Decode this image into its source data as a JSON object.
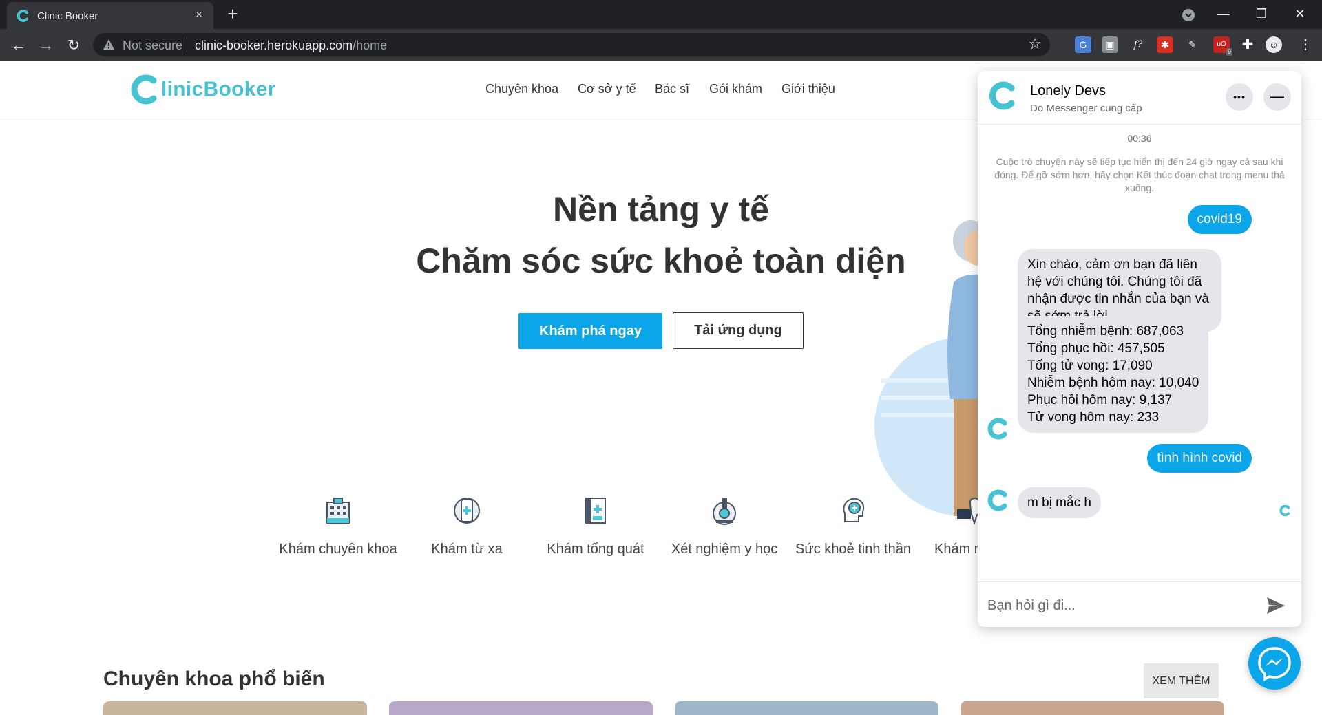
{
  "browser": {
    "tab_title": "Clinic Booker",
    "tab_close": "×",
    "new_tab": "+",
    "security_label": "Not secure",
    "url_host": "clinic-booker.herokuapp.com",
    "url_path": "/home",
    "window_controls": {
      "minimize": "—",
      "restore": "❐",
      "close": "✕"
    },
    "nav": {
      "back": "←",
      "forward": "→",
      "reload": "↻"
    },
    "star": "☆",
    "extension_badge": "9"
  },
  "header": {
    "logo_text": "linicBooker",
    "nav": [
      "Chuyên khoa",
      "Cơ sở y tế",
      "Bác sĩ",
      "Gói khám",
      "Giới thiệu"
    ]
  },
  "hero": {
    "title_line1": "Nền tảng y tế",
    "title_line2": "Chăm sóc sức khoẻ toàn diện",
    "primary_button": "Khám phá ngay",
    "secondary_button": "Tải ứng dụng"
  },
  "services": [
    {
      "label": "Khám chuyên khoa",
      "icon": "hospital-icon"
    },
    {
      "label": "Khám từ xa",
      "icon": "phone-medical-icon"
    },
    {
      "label": "Khám tổng quát",
      "icon": "clipboard-medical-icon"
    },
    {
      "label": "Xét nghiệm y học",
      "icon": "microscope-icon"
    },
    {
      "label": "Sức khoẻ tinh thần",
      "icon": "head-brain-icon"
    },
    {
      "label": "Khám n",
      "icon": "tooth-icon"
    }
  ],
  "section": {
    "title": "Chuyên khoa phổ biến",
    "see_more": "XEM THÊM"
  },
  "chat": {
    "page_name": "Lonely Devs",
    "subtitle": "Do Messenger cung cấp",
    "more_button": "•••",
    "minimize_button": "—",
    "time": "00:36",
    "notice": "Cuộc trò chuyện này sẽ tiếp tục hiển thị đến 24 giờ ngay cả sau khi đóng. Để gỡ sớm hơn, hãy chọn Kết thúc đoạn chat trong menu thả xuống.",
    "messages": [
      {
        "from": "user",
        "text": "covid19"
      },
      {
        "from": "bot",
        "text": "Xin chào, cảm ơn bạn đã liên hệ với chúng tôi. Chúng tôi đã nhận được tin nhắn của bạn và sẽ sớm trả lời."
      },
      {
        "from": "bot",
        "lines": [
          "Tổng nhiễm bệnh: 687,063",
          "Tổng phục hồi: 457,505",
          "Tổng tử vong: 17,090",
          "Nhiễm bệnh hôm nay: 10,040",
          "Phục hồi hôm nay: 9,137",
          "Tử vong hôm nay: 233"
        ]
      },
      {
        "from": "user",
        "text": "tình hình covid"
      },
      {
        "from": "bot",
        "text": "m bị mắc h"
      }
    ],
    "input_placeholder": "Bạn hỏi gì đi..."
  },
  "colors": {
    "brand_teal": "#45c3d2",
    "primary_blue": "#0ba5e9",
    "chrome_dark": "#202124",
    "chrome_toolbar": "#35363a"
  }
}
